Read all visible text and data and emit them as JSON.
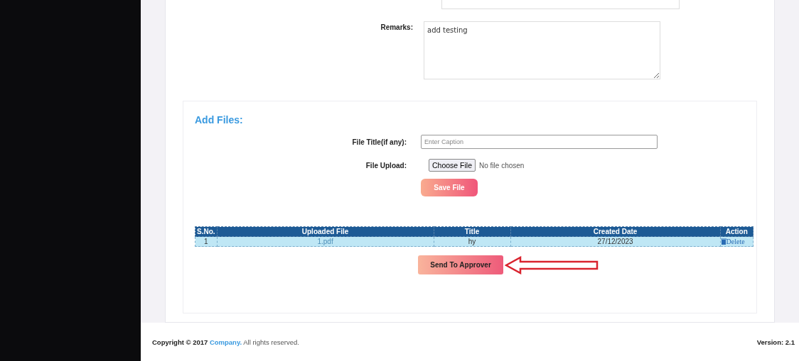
{
  "remarks": {
    "label": "Remarks:",
    "value": "add testing"
  },
  "add_files": {
    "heading": "Add Files:",
    "file_title": {
      "label": "File Title(if any):",
      "placeholder": "Enter Caption"
    },
    "file_upload": {
      "label": "File Upload:",
      "button": "Choose File",
      "status": "No file chosen"
    },
    "save_button": "Save File"
  },
  "table": {
    "columns": [
      "S.No.",
      "Uploaded File",
      "Title",
      "Created Date",
      "Action"
    ],
    "rows": [
      {
        "cells": [
          "1",
          "1.pdf",
          "hy",
          "27/12/2023",
          "Delete"
        ]
      }
    ]
  },
  "send_button": "Send To Approver",
  "footer": {
    "copyright": "**Copyright © 2017**",
    "company": "Company.",
    "rest": "All rights reserved.",
    "version": "Version: 2.1"
  }
}
